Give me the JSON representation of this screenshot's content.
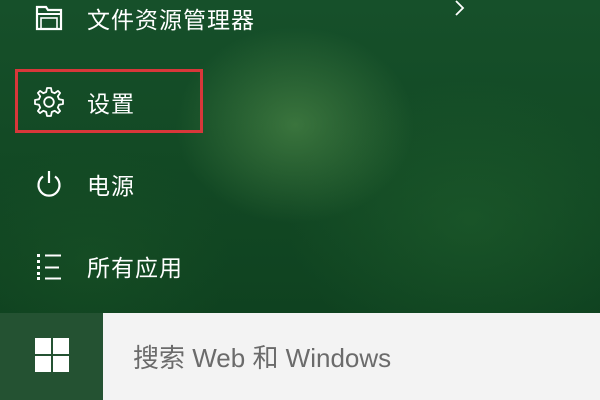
{
  "start_menu": {
    "items": [
      {
        "label": "文件资源管理器",
        "icon": "folder-icon",
        "has_submenu": true
      },
      {
        "label": "设置",
        "icon": "gear-icon",
        "highlighted": true
      },
      {
        "label": "电源",
        "icon": "power-icon"
      },
      {
        "label": "所有应用",
        "icon": "list-icon"
      }
    ],
    "highlight_color": "#d8373a",
    "background_color": "#134a25"
  },
  "taskbar": {
    "start_icon": "windows-logo-icon",
    "search": {
      "placeholder": "搜索 Web 和 Windows"
    }
  }
}
